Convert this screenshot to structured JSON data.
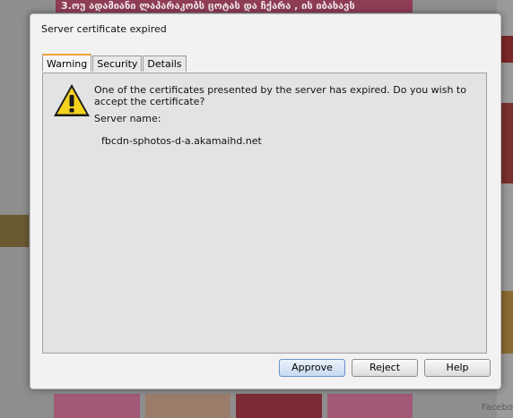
{
  "background": {
    "banner_text": "3.ოუ ადამიანი ლაპარაკობს ცოტას და ჩქარა , ის იბახავს",
    "footer_text": "Facebo"
  },
  "dialog": {
    "title": "Server certificate expired",
    "tabs": [
      {
        "label": "Warning",
        "active": true
      },
      {
        "label": "Security",
        "active": false
      },
      {
        "label": "Details",
        "active": false
      }
    ],
    "message": "One of the certificates presented by the server has expired. Do you wish to accept the certificate?",
    "server_name_label": "Server name:",
    "server_name_value": "fbcdn-sphotos-d-a.akamaihd.net",
    "icon": "warning-triangle-icon",
    "buttons": {
      "approve": "Approve",
      "reject": "Reject",
      "help": "Help"
    }
  },
  "colors": {
    "accent_tab": "#f0a33a",
    "warning_yellow": "#f5d21e",
    "primary_button": "#c7daf1"
  }
}
